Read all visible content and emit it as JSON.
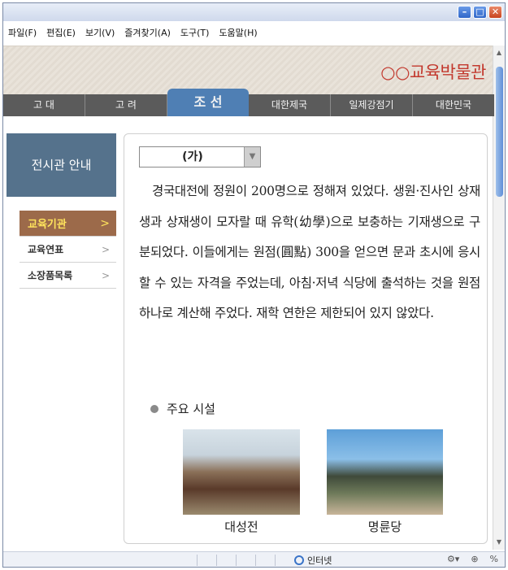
{
  "menu": [
    "파일(F)",
    "편집(E)",
    "보기(V)",
    "즐겨찾기(A)",
    "도구(T)",
    "도움말(H)"
  ],
  "site_title": "○○교육박물관",
  "nav": {
    "tabs": [
      "고 대",
      "고 려",
      "조 선",
      "대한제국",
      "일제강점기",
      "대한민국"
    ],
    "active": "조 선"
  },
  "sidebar": {
    "heading": "전시관 안내",
    "items": [
      {
        "label": "교육기관",
        "arrow": ">"
      },
      {
        "label": "교육연표",
        "arrow": ">"
      },
      {
        "label": "소장품목록",
        "arrow": ">"
      }
    ]
  },
  "content": {
    "select_value": "(가)",
    "paragraph": "경국대전에 정원이 200명으로 정해져 있었다. 생원·진사인 상재생과 상재생이 모자랄 때 유학(幼學)으로 보충하는 기재생으로 구분되었다. 이들에게는 원점(圓點) 300을 얻으면 문과 초시에 응시할 수 있는 자격을 주었는데, 아침·저녁 식당에 출석하는 것을 원점 하나로 계산해 주었다. 재학 연한은 제한되어 있지 않았다.",
    "facilities_heading": "주요 시설",
    "photos": [
      {
        "caption": "대성전"
      },
      {
        "caption": "명륜당"
      }
    ]
  },
  "status": {
    "zone": "인터넷",
    "zoom": "%"
  }
}
